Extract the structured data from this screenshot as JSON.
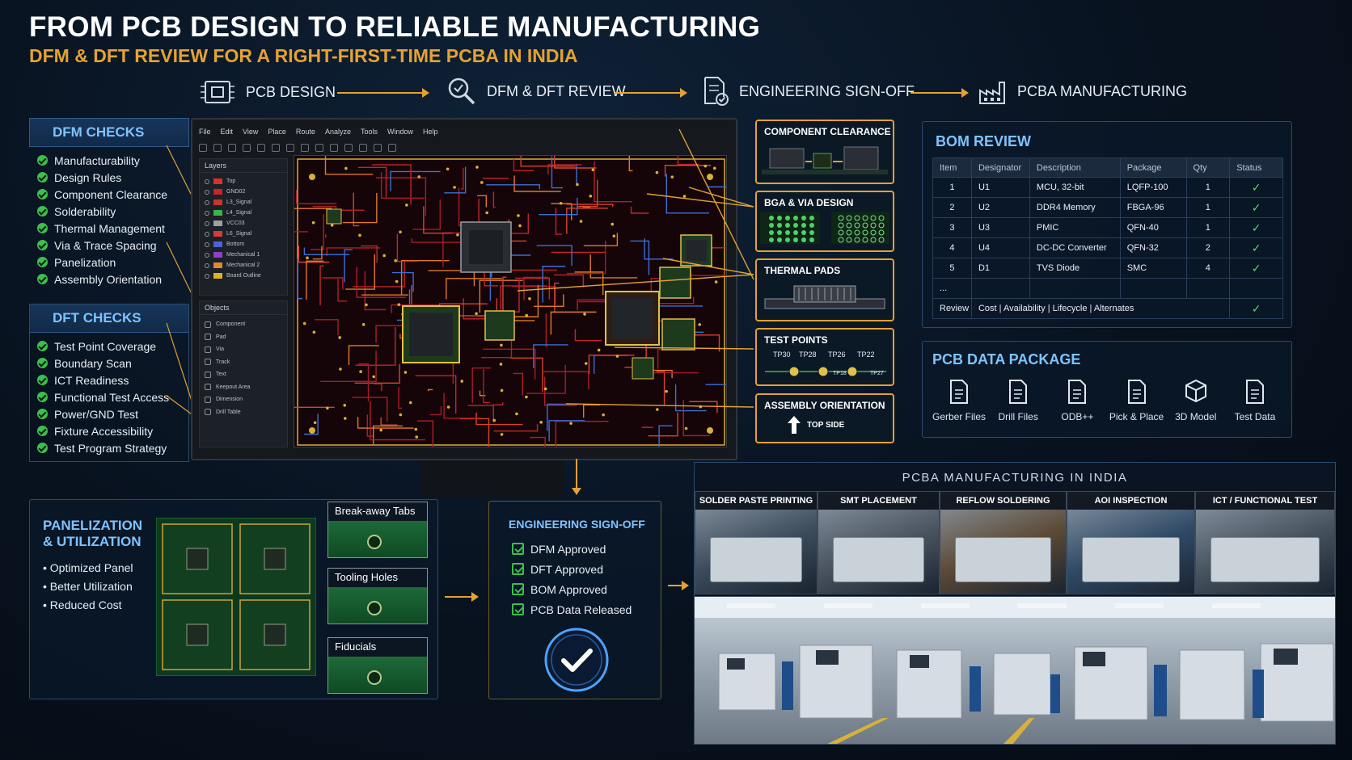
{
  "header": {
    "title": "FROM PCB DESIGN TO RELIABLE MANUFACTURING",
    "subtitle": "DFM & DFT REVIEW FOR A RIGHT-FIRST-TIME PCBA IN INDIA"
  },
  "flow": [
    {
      "label": "PCB DESIGN",
      "icon": "chip-icon"
    },
    {
      "label": "DFM & DFT REVIEW",
      "icon": "magnifier-icon"
    },
    {
      "label": "ENGINEERING SIGN-OFF",
      "icon": "document-check-icon"
    },
    {
      "label": "PCBA MANUFACTURING",
      "icon": "factory-icon"
    }
  ],
  "dfm": {
    "title": "DFM CHECKS",
    "items": [
      "Manufacturability",
      "Design Rules",
      "Component Clearance",
      "Solderability",
      "Thermal Management",
      "Via & Trace Spacing",
      "Panelization",
      "Assembly Orientation"
    ]
  },
  "dft": {
    "title": "DFT CHECKS",
    "items": [
      "Test Point Coverage",
      "Boundary Scan",
      "ICT Readiness",
      "Functional Test Access",
      "Power/GND Test",
      "Fixture Accessibility",
      "Test Program Strategy"
    ]
  },
  "editor": {
    "menu": [
      "File",
      "Edit",
      "View",
      "Place",
      "Route",
      "Analyze",
      "Tools",
      "Window",
      "Help"
    ],
    "layers_title": "Layers",
    "layers": [
      {
        "name": "Top",
        "color": "#d9312b"
      },
      {
        "name": "GND02",
        "color": "#c7252a"
      },
      {
        "name": "L3_Signal",
        "color": "#c03a2c"
      },
      {
        "name": "L4_Signal",
        "color": "#3bb34a"
      },
      {
        "name": "VCC03",
        "color": "#9aa0a6"
      },
      {
        "name": "L6_Signal",
        "color": "#d63b3b"
      },
      {
        "name": "Bottom",
        "color": "#4b63d6"
      },
      {
        "name": "Mechanical 1",
        "color": "#8e3fc6"
      },
      {
        "name": "Mechanical 2",
        "color": "#e08a2c"
      },
      {
        "name": "Board Outline",
        "color": "#e0b02c"
      }
    ],
    "objects_title": "Objects",
    "objects": [
      "Component",
      "Pad",
      "Via",
      "Track",
      "Text",
      "Keepout Area",
      "Dimension",
      "Drill Table"
    ]
  },
  "callouts": {
    "component_clearance": "COMPONENT CLEARANCE",
    "bga_via": "BGA & VIA DESIGN",
    "thermal_pads": "THERMAL PADS",
    "test_points": {
      "title": "TEST POINTS",
      "labels": [
        "TP30",
        "TP28",
        "TP26",
        "TP22",
        "TP18",
        "TP27"
      ]
    },
    "assembly": {
      "title": "ASSEMBLY ORIENTATION",
      "side": "TOP SIDE"
    }
  },
  "bom": {
    "title": "BOM REVIEW",
    "columns": [
      "Item",
      "Designator",
      "Description",
      "Package",
      "Qty",
      "Status"
    ],
    "rows": [
      {
        "item": "1",
        "designator": "U1",
        "description": "MCU, 32-bit",
        "package": "LQFP-100",
        "qty": "1",
        "status": "✓"
      },
      {
        "item": "2",
        "designator": "U2",
        "description": "DDR4 Memory",
        "package": "FBGA-96",
        "qty": "1",
        "status": "✓"
      },
      {
        "item": "3",
        "designator": "U3",
        "description": "PMIC",
        "package": "QFN-40",
        "qty": "1",
        "status": "✓"
      },
      {
        "item": "4",
        "designator": "U4",
        "description": "DC-DC Converter",
        "package": "QFN-32",
        "qty": "2",
        "status": "✓"
      },
      {
        "item": "5",
        "designator": "D1",
        "description": "TVS Diode",
        "package": "SMC",
        "qty": "4",
        "status": "✓"
      }
    ],
    "ellipsis": "...",
    "review_label": "Review",
    "review_text": "Cost | Availability | Lifecycle | Alternates",
    "review_status": "✓"
  },
  "package": {
    "title": "PCB DATA PACKAGE",
    "items": [
      "Gerber Files",
      "Drill Files",
      "ODB++",
      "Pick & Place",
      "3D Model",
      "Test Data"
    ]
  },
  "panelization": {
    "title_line1": "PANELIZATION",
    "title_line2": "& UTILIZATION",
    "bullets": [
      "Optimized Panel",
      "Better Utilization",
      "Reduced Cost"
    ],
    "features": [
      "Break-away Tabs",
      "Tooling Holes",
      "Fiducials"
    ]
  },
  "signoff": {
    "title": "ENGINEERING SIGN-OFF",
    "items": [
      "DFM Approved",
      "DFT Approved",
      "BOM Approved",
      "PCB Data Released"
    ]
  },
  "manufacturing": {
    "title": "PCBA MANUFACTURING IN INDIA",
    "steps": [
      "SOLDER PASTE PRINTING",
      "SMT PLACEMENT",
      "REFLOW SOLDERING",
      "AOI INSPECTION",
      "ICT / FUNCTIONAL TEST"
    ]
  },
  "colors": {
    "accent": "#e4a233",
    "panel_title": "#7fc3ff",
    "check": "#3cc04a",
    "background": "#08121f"
  }
}
